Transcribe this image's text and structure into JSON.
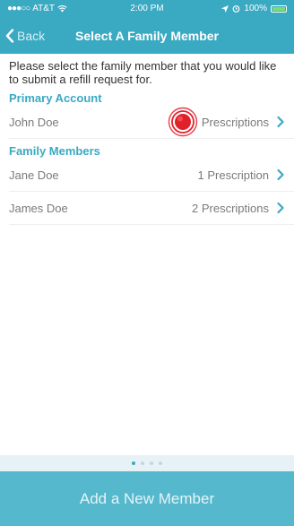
{
  "status_bar": {
    "carrier": "AT&T",
    "time": "2:00 PM",
    "battery": "100%"
  },
  "nav": {
    "back_label": "Back",
    "title": "Select A Family Member"
  },
  "intro_text": "Please select the family member that you would like to submit a refill request for.",
  "primary_section": {
    "header": "Primary Account",
    "members": [
      {
        "name": "John Doe",
        "prescriptions": "Prescriptions"
      }
    ]
  },
  "family_section": {
    "header": "Family Members",
    "members": [
      {
        "name": "Jane Doe",
        "prescriptions": "1 Prescription"
      },
      {
        "name": "James Doe",
        "prescriptions": "2 Prescriptions"
      }
    ]
  },
  "pager": {
    "pages": 4,
    "active_index": 0
  },
  "add_button_label": "Add a New Member",
  "colors": {
    "accent": "#3aa9c2",
    "button": "#56b8cc",
    "tap_marker": "#e0202a"
  },
  "icons": {
    "back": "chevron-left-icon",
    "row": "chevron-right-icon",
    "wifi": "wifi-icon",
    "location": "location-arrow-icon",
    "alarm": "alarm-icon",
    "battery": "battery-icon"
  }
}
